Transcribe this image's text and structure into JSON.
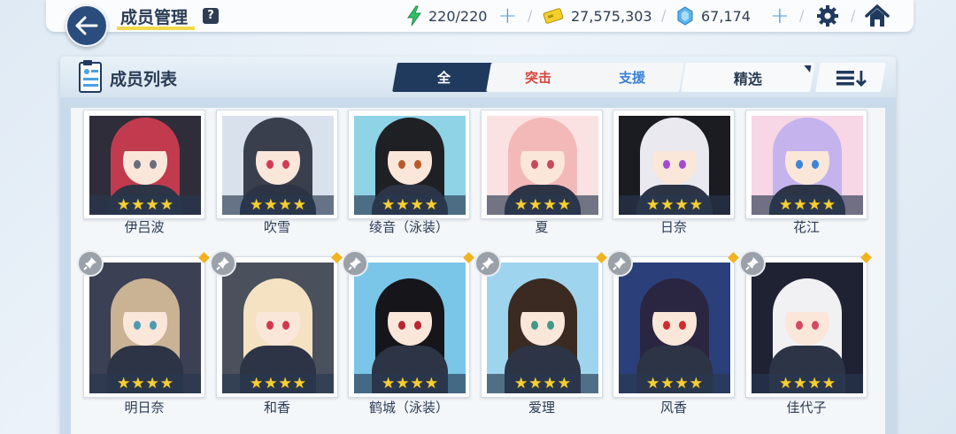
{
  "header": {
    "title": "成员管理",
    "help_label": "?",
    "ap": "220/220",
    "credits": "27,575,303",
    "pyroxene": "67,174"
  },
  "panel": {
    "title": "成员列表",
    "tabs": [
      {
        "label": "全",
        "active": true
      },
      {
        "label": "突击",
        "active": false
      },
      {
        "label": "支援",
        "active": false
      }
    ],
    "filter_label": "精选"
  },
  "colors": {
    "accent": "#203a5e",
    "striker": "#d7453c",
    "special": "#3c7fd5",
    "star": "#f6cf34",
    "ap_icon": "#34c06a",
    "credit_icon": "#f2cf2a",
    "pyroxene_icon": "#5ab4ee"
  },
  "students_row1": [
    {
      "name": "伊吕波",
      "stars": 4,
      "hair": "#c23a4e",
      "bg": "#2f2d3a",
      "eye": "#6a6f7d"
    },
    {
      "name": "吹雪",
      "stars": 4,
      "hair": "#3a3f4d",
      "bg": "#d9e2ec",
      "eye": "#d13a55"
    },
    {
      "name": "绫音（泳装）",
      "stars": 4,
      "hair": "#1f2024",
      "bg": "#8fd3e6",
      "eye": "#b85a2a"
    },
    {
      "name": "夏",
      "stars": 4,
      "hair": "#f3b9b9",
      "bg": "#fbe2e2",
      "eye": "#c54a5b"
    },
    {
      "name": "日奈",
      "stars": 4,
      "hair": "#e9e9ef",
      "bg": "#1b1b22",
      "eye": "#a04bd0"
    },
    {
      "name": "花江",
      "stars": 4,
      "hair": "#c5b3ee",
      "bg": "#f7d6e5",
      "eye": "#3b86d6"
    }
  ],
  "students_row2": [
    {
      "name": "明日奈",
      "stars": 4,
      "hair": "#c9b394",
      "bg": "#3c4054",
      "eye": "#4b9ab0"
    },
    {
      "name": "和香",
      "stars": 4,
      "hair": "#f4e2c2",
      "bg": "#4a505c",
      "eye": "#d2394b"
    },
    {
      "name": "鹤城（泳装）",
      "stars": 4,
      "hair": "#15151a",
      "bg": "#7ac6e8",
      "eye": "#b8262d"
    },
    {
      "name": "爱理",
      "stars": 4,
      "hair": "#3a2a22",
      "bg": "#9fd4ee",
      "eye": "#3e9a86"
    },
    {
      "name": "风香",
      "stars": 4,
      "hair": "#2a2540",
      "bg": "#2b3f7a",
      "eye": "#d42a2a"
    },
    {
      "name": "佳代子",
      "stars": 4,
      "hair": "#f1f1f3",
      "bg": "#1e2233",
      "eye": "#d24a63"
    }
  ]
}
